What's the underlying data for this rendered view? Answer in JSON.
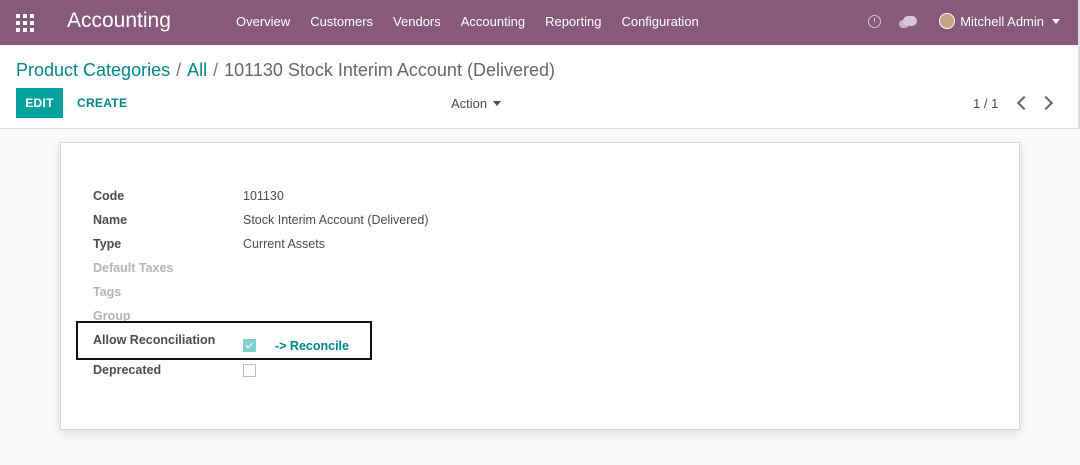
{
  "navbar": {
    "app_title": "Accounting",
    "menu": [
      "Overview",
      "Customers",
      "Vendors",
      "Accounting",
      "Reporting",
      "Configuration"
    ],
    "user_name": "Mitchell Admin",
    "icons": [
      "apps-grid-icon",
      "clock-icon",
      "chat-icon"
    ],
    "color": "#875a7b"
  },
  "breadcrumb": {
    "items": [
      "Product Categories",
      "All"
    ],
    "separator": "/",
    "current": "101130 Stock Interim Account (Delivered)"
  },
  "toolbar": {
    "edit_label": "EDIT",
    "create_label": "CREATE",
    "action_label": "Action",
    "pager": "1 / 1"
  },
  "form": {
    "fields": [
      {
        "label": "Code",
        "value": "101130"
      },
      {
        "label": "Name",
        "value": "Stock Interim Account (Delivered)"
      },
      {
        "label": "Type",
        "value": "Current Assets"
      },
      {
        "label": "Default Taxes",
        "value": ""
      },
      {
        "label": "Tags",
        "value": ""
      },
      {
        "label": "Group",
        "value": ""
      }
    ],
    "allow_reconciliation": {
      "label": "Allow Reconciliation",
      "checked": true,
      "link": "-> Reconcile"
    },
    "deprecated": {
      "label": "Deprecated",
      "checked": false
    }
  },
  "colors": {
    "accent": "#00a09d",
    "link": "#00868a"
  }
}
